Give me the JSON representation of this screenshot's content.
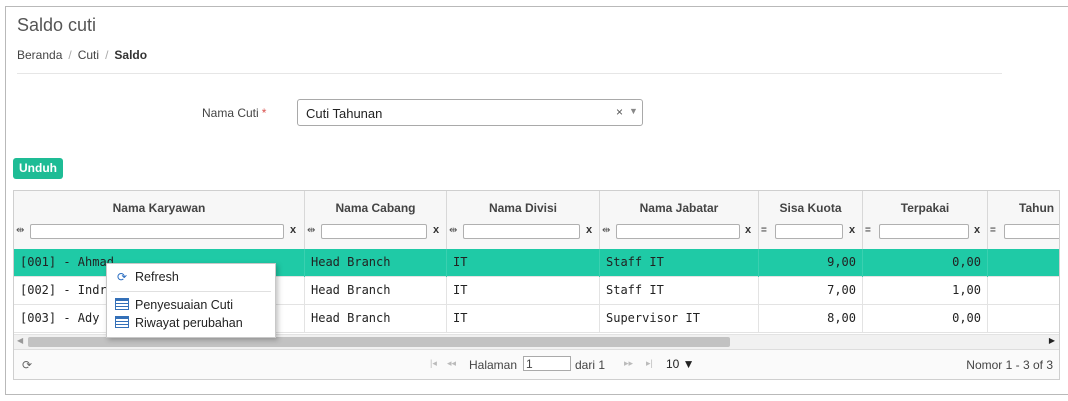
{
  "page": {
    "title": "Saldo cuti"
  },
  "breadcrumb": {
    "items": [
      "Beranda",
      "Cuti"
    ],
    "current": "Saldo",
    "separator": "/"
  },
  "form": {
    "label": "Nama Cuti",
    "required_mark": "*",
    "value": "Cuti Tahunan",
    "clear": "×",
    "arrow": "▼"
  },
  "toolbar": {
    "download_label": "Unduh"
  },
  "table": {
    "columns": [
      {
        "label": "Nama Karyawan",
        "filter_icon": "⇹",
        "clear": "x"
      },
      {
        "label": "Nama Cabang",
        "filter_icon": "⇹",
        "clear": "x"
      },
      {
        "label": "Nama Divisi",
        "filter_icon": "⇹",
        "clear": "x"
      },
      {
        "label": "Nama Jabatar",
        "filter_icon": "⇹",
        "clear": "x"
      },
      {
        "label": "Sisa Kuota",
        "filter_icon": "=",
        "clear": "x"
      },
      {
        "label": "Terpakai",
        "filter_icon": "=",
        "clear": "x"
      },
      {
        "label": "Tahun",
        "filter_icon": "=",
        "clear": ""
      }
    ],
    "rows": [
      [
        "[001] - Ahmad",
        "Head Branch",
        "IT",
        "Staff IT",
        "9,00",
        "0,00",
        ""
      ],
      [
        "[002] - Indra",
        "Head Branch",
        "IT",
        "Staff IT",
        "7,00",
        "1,00",
        ""
      ],
      [
        "[003] - Ady",
        "Head Branch",
        "IT",
        "Supervisor IT",
        "8,00",
        "0,00",
        ""
      ]
    ],
    "selected_row": 0
  },
  "pager": {
    "refresh_icon": "⟳",
    "first": "|◂",
    "prev": "◂◂",
    "next": "▸▸",
    "last": "▸|",
    "page_label": "Halaman",
    "page_value": "1",
    "of_label": "dari 1",
    "page_size": "10 ▼",
    "info": "Nomor 1 - 3 of 3"
  },
  "context_menu": {
    "items": [
      "Refresh",
      "Penyesuaian Cuti",
      "Riwayat perubahan"
    ],
    "refresh_icon": "⟳"
  },
  "colors": {
    "accent": "#1ebc95",
    "selected_row": "#1fcaa6"
  }
}
